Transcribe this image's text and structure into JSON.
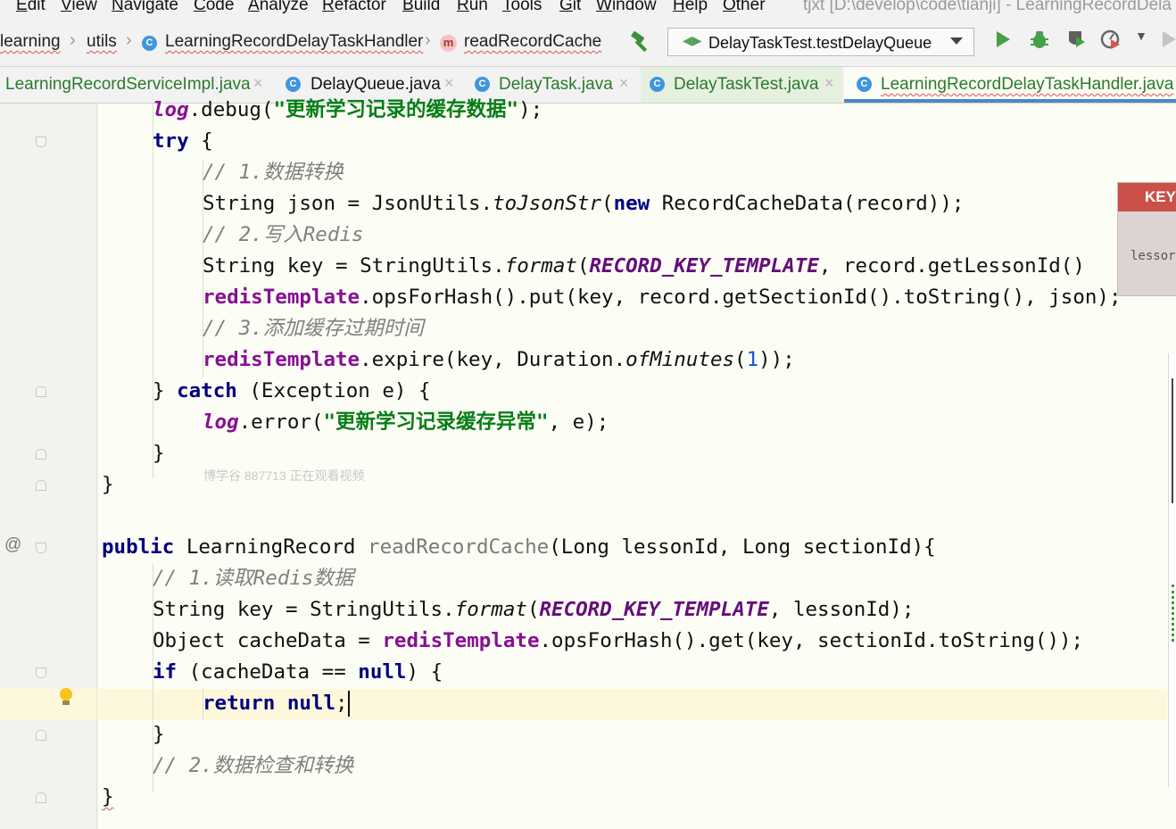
{
  "menu": {
    "items": [
      "Edit",
      "View",
      "Navigate",
      "Code",
      "Analyze",
      "Refactor",
      "Build",
      "Run",
      "Tools",
      "Git",
      "Window",
      "Help",
      "Other"
    ],
    "window_title": "tjxt [D:\\develop\\code\\tianji] - LearningRecordDela"
  },
  "breadcrumb": {
    "items": [
      "learning",
      "utils",
      "LearningRecordDelayTaskHandler",
      "readRecordCache"
    ]
  },
  "toolbar": {
    "run_config": "DelayTaskTest.testDelayQueue",
    "icons": [
      "build-hammer-icon",
      "run-icon",
      "debug-icon",
      "coverage-icon",
      "profile-icon",
      "stop-icon"
    ]
  },
  "tabs": [
    {
      "label": "LearningRecordServiceImpl.java",
      "close": "×",
      "active": false
    },
    {
      "label": "DelayQueue.java",
      "close": "×",
      "active": false
    },
    {
      "label": "DelayTask.java",
      "close": "×",
      "active": false
    },
    {
      "label": "DelayTaskTest.java",
      "close": "×",
      "active": false
    },
    {
      "label": "LearningRecordDelayTaskHandler.java",
      "close": "",
      "active": true
    }
  ],
  "code": {
    "lines": [
      "log.debug(\"更新学习记录的缓存数据\");",
      "try {",
      "// 1.数据转换",
      "String json = JsonUtils.toJsonStr(new RecordCacheData(record));",
      "// 2.写入Redis",
      "String key = StringUtils.format(RECORD_KEY_TEMPLATE, record.getLessonId()",
      "redisTemplate.opsForHash().put(key, record.getSectionId().toString(), json);",
      "// 3.添加缓存过期时间",
      "redisTemplate.expire(key, Duration.ofMinutes(1));",
      "} catch (Exception e) {",
      "log.error(\"更新学习记录缓存异常\", e);",
      "}",
      "}",
      "",
      "public LearningRecord readRecordCache(Long lessonId, Long sectionId){",
      "// 1.读取Redis数据",
      "String key = StringUtils.format(RECORD_KEY_TEMPLATE, lessonId);",
      "Object cacheData = redisTemplate.opsForHash().get(key, sectionId.toString());",
      "if (cacheData == null) {",
      "return null;",
      "}",
      "// 2.数据检查和转换",
      "}"
    ],
    "tokens": {
      "t0": [
        "log",
        ".debug(",
        "\"更新学习记录的缓存数据\"",
        ");"
      ],
      "t1": [
        "try",
        " {"
      ],
      "t2": [
        "// 1.数据转换"
      ],
      "t3": [
        "String json = JsonUtils.",
        "toJsonStr",
        "(",
        "new",
        " RecordCacheData(record));"
      ],
      "t4": [
        "// 2.写入Redis"
      ],
      "t5": [
        "String key = StringUtils.",
        "format",
        "(",
        "RECORD_KEY_TEMPLATE",
        ", record.getLessonId()"
      ],
      "t6": [
        "redisTemplate",
        ".opsForHash().put(key, record.getSectionId().toString(), json);"
      ],
      "t7": [
        "// 3.添加缓存过期时间"
      ],
      "t8": [
        "redisTemplate",
        ".expire(key, Duration.",
        "ofMinutes",
        "(",
        "1",
        "));"
      ],
      "t9": [
        "} ",
        "catch",
        " (Exception e) {"
      ],
      "t10": [
        "log",
        ".error(",
        "\"更新学习记录缓存异常\"",
        ", e);"
      ],
      "t11": [
        "}"
      ],
      "t12": [
        "}"
      ],
      "t14": [
        "public",
        " LearningRecord ",
        "readRecordCache",
        "(Long lessonId, Long sectionId){"
      ],
      "t15": [
        "// 1.读取Redis数据"
      ],
      "t16": [
        "String key = StringUtils.",
        "format",
        "(",
        "RECORD_KEY_TEMPLATE",
        ", lessonId);"
      ],
      "t17": [
        "Object cacheData = ",
        "redisTemplate",
        ".opsForHash().get(key, sectionId.toString());"
      ],
      "t18": [
        "if",
        " (cacheData == ",
        "null",
        ") {"
      ],
      "t19": [
        "return",
        " ",
        "null",
        ";"
      ],
      "t20": [
        "}"
      ],
      "t21": [
        "// 2.数据检查和转换"
      ],
      "t22": [
        "}"
      ]
    }
  },
  "watermark": "博学谷 887713 正在观看视频",
  "popup": {
    "header": "KEY",
    "body": "lessor"
  },
  "gutter": {
    "override_marker": "@"
  },
  "colors": {
    "keyword": "#000080",
    "string": "#067d17",
    "field": "#871094",
    "comment": "#808080",
    "number": "#1750eb",
    "active_tab_underline": "#4a88c7",
    "caret_line": "#fdf8dc",
    "popup_header": "#c9514a"
  }
}
